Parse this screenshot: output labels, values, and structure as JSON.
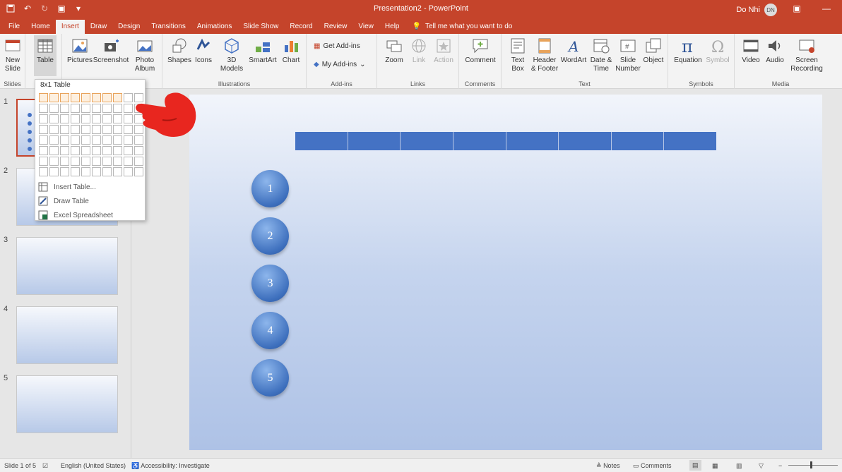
{
  "app": {
    "doc_title": "Presentation2 - PowerPoint",
    "user_name": "Do Nhi",
    "user_initials": "DN"
  },
  "tabs": [
    "File",
    "Home",
    "Insert",
    "Draw",
    "Design",
    "Transitions",
    "Animations",
    "Slide Show",
    "Record",
    "Review",
    "View",
    "Help"
  ],
  "active_tab": "Insert",
  "tell_me": "Tell me what you want to do",
  "ribbon": {
    "slides": {
      "label": "Slides",
      "new_slide": "New Slide"
    },
    "tables": {
      "table": "Table"
    },
    "images": {
      "pictures": "Pictures",
      "screenshot": "Screenshot",
      "photo_album": "Photo Album"
    },
    "illustrations": {
      "label": "Illustrations",
      "shapes": "Shapes",
      "icons": "Icons",
      "models": "3D Models",
      "smartart": "SmartArt",
      "chart": "Chart"
    },
    "addins": {
      "label": "Add-ins",
      "get": "Get Add-ins",
      "my": "My Add-ins"
    },
    "links": {
      "label": "Links",
      "zoom": "Zoom",
      "link": "Link",
      "action": "Action"
    },
    "comments": {
      "label": "Comments",
      "comment": "Comment"
    },
    "text": {
      "label": "Text",
      "textbox": "Text Box",
      "header": "Header & Footer",
      "wordart": "WordArt",
      "datetime": "Date & Time",
      "slidenum": "Slide Number",
      "object": "Object"
    },
    "symbols": {
      "label": "Symbols",
      "equation": "Equation",
      "symbol": "Symbol"
    },
    "media": {
      "label": "Media",
      "video": "Video",
      "audio": "Audio",
      "screenrec": "Screen Recording"
    }
  },
  "table_dropdown": {
    "title": "8x1 Table",
    "insert_table": "Insert Table...",
    "draw_table": "Draw Table",
    "excel": "Excel Spreadsheet",
    "grid_cols": 10,
    "grid_rows": 8,
    "selected_cols": 8,
    "selected_rows": 1
  },
  "thumbnails": [
    "1",
    "2",
    "3",
    "4",
    "5"
  ],
  "slide": {
    "table_cols": 8,
    "circles": [
      "1",
      "2",
      "3",
      "4",
      "5"
    ],
    "accent": "#4472c4"
  },
  "status": {
    "slide_info": "Slide 1 of 5",
    "language": "English (United States)",
    "accessibility": "Accessibility: Investigate",
    "notes": "Notes",
    "comments": "Comments"
  },
  "colors": {
    "brand": "#c5442b",
    "table_fill": "#4472c4"
  }
}
